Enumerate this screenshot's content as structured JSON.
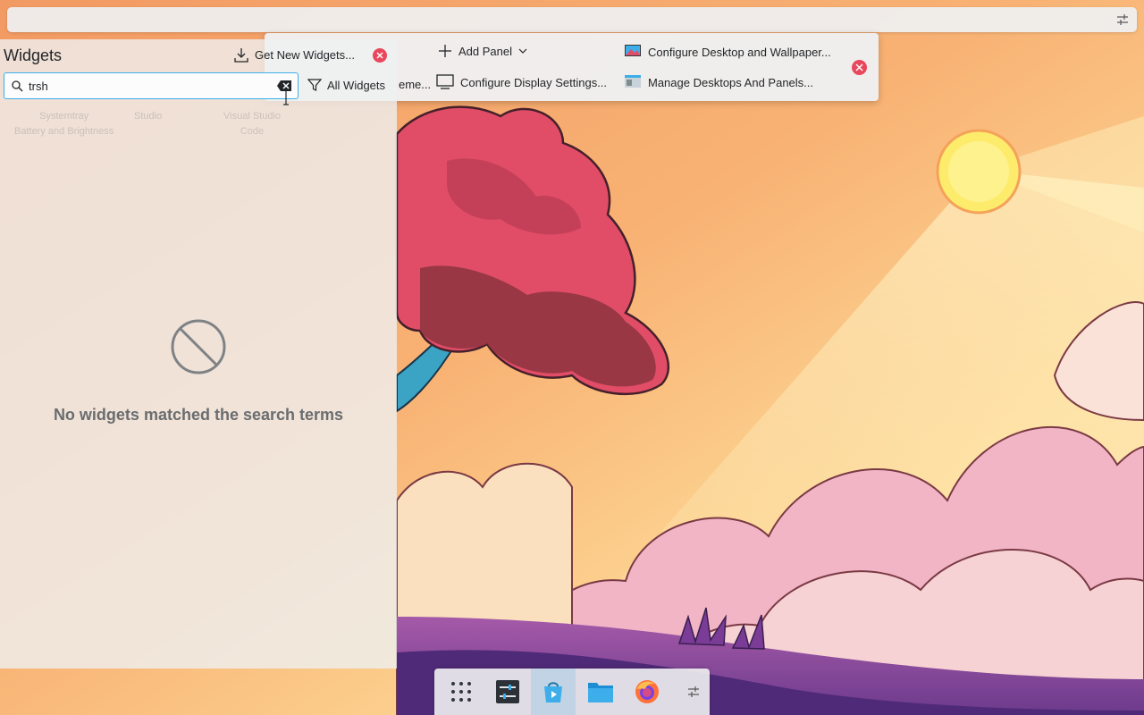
{
  "top_panel": {
    "config_icon": "panel-settings-icon"
  },
  "edit_toolbar": {
    "add_panel": "Add Panel",
    "global_themes_truncated": "eme...",
    "configure_display": "Configure Display Settings...",
    "configure_desktop": "Configure Desktop and Wallpaper...",
    "manage_desktops": "Manage Desktops And Panels..."
  },
  "widgets_panel": {
    "title": "Widgets",
    "get_new_label": "Get New Widgets...",
    "search_value": "trsh",
    "filter_label": "All Widgets",
    "faded_results": [
      "Systemtray",
      "Battery and Brightness",
      "Studio",
      "Visual Studio",
      "Code"
    ],
    "empty_message": "No widgets matched the search terms"
  },
  "taskbar": {
    "items": [
      "app-launcher-icon",
      "system-settings-icon",
      "discover-icon",
      "dolphin-icon",
      "firefox-icon",
      "panel-settings-icon"
    ]
  },
  "colors": {
    "accent": "#3daee9",
    "close_red": "#e9475c",
    "panel_bg": "#eff0f1"
  }
}
